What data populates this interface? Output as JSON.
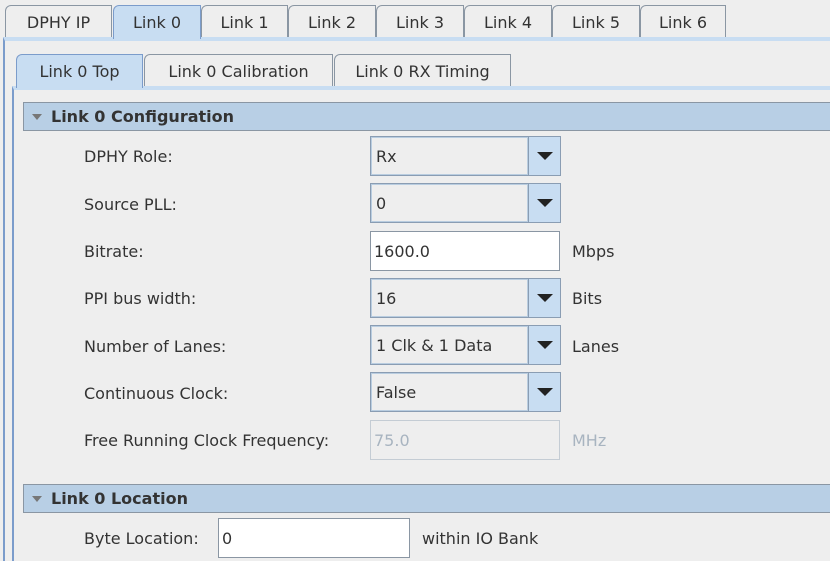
{
  "outer_tabs": [
    "DPHY IP",
    "Link 0",
    "Link 1",
    "Link 2",
    "Link 3",
    "Link 4",
    "Link 5",
    "Link 6"
  ],
  "inner_tabs": [
    "Link 0 Top",
    "Link 0 Calibration",
    "Link 0 RX Timing"
  ],
  "config": {
    "title": "Link 0 Configuration",
    "dphy_role": {
      "label": "DPHY Role:",
      "value": "Rx"
    },
    "source_pll": {
      "label": "Source PLL:",
      "value": "0"
    },
    "bitrate": {
      "label": "Bitrate:",
      "value": "1600.0",
      "unit": "Mbps"
    },
    "ppi": {
      "label": "PPI bus width:",
      "value": "16",
      "unit": "Bits"
    },
    "lanes": {
      "label": "Number of Lanes:",
      "value": "1 Clk & 1 Data",
      "unit": "Lanes"
    },
    "cont_clock": {
      "label": "Continuous Clock:",
      "value": "False"
    },
    "free_clock": {
      "label": "Free Running Clock Frequency:",
      "value": "75.0",
      "unit": "MHz"
    }
  },
  "location": {
    "title": "Link 0 Location",
    "byte": {
      "label": "Byte Location:",
      "value": "0",
      "unit": "within IO Bank"
    }
  }
}
